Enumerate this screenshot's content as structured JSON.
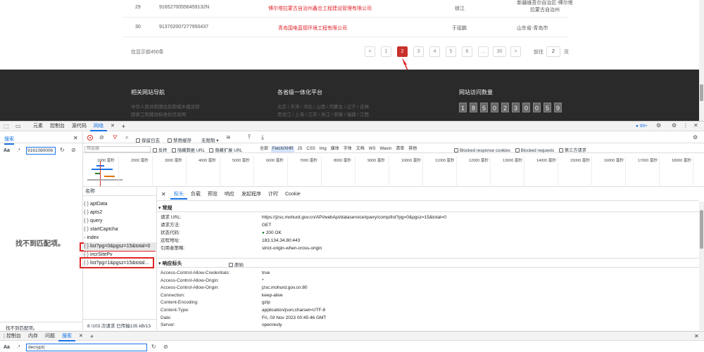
{
  "table_rows": [
    {
      "num": "29",
      "code": "91652700556459132N",
      "company": "博尔塔拉蒙古自治州鑫合工程建设管理有限公司",
      "person": "徐江",
      "region": "新疆维吾尔自治区-博尔塔拉蒙古自治州"
    },
    {
      "num": "30",
      "code": "913702007277950437",
      "company": "青岛国电蓝德环境工程有限公司",
      "person": "于延鹏",
      "region": "山东省-青岛市"
    }
  ],
  "pagination": {
    "summary": "仅显示前450条",
    "prev": "<",
    "pages": [
      "1",
      "2",
      "3",
      "4",
      "5",
      "6",
      "...",
      "30"
    ],
    "active": "2",
    "next": ">",
    "goto_label": "前往",
    "goto_value": "2",
    "goto_suffix": "页"
  },
  "footer": {
    "nav_title": "相关网站导航",
    "nav_links": [
      "中华人民共和国住房和城乡建设部",
      "国家工程建设标准化信息网"
    ],
    "province_title": "各省级一体化平台",
    "province_line1": "北京 / 天津 / 河北 / 山西 / 内蒙古 / 辽宁 / 吉林",
    "province_line2": "黑龙江 / 上海 / 江苏 / 浙江 / 安徽 / 福建 / 江西",
    "visits_title": "网站访问数量",
    "visits_digits": [
      "1",
      "8",
      "5",
      "0",
      "2",
      "3",
      "0",
      "0",
      "5",
      "9"
    ]
  },
  "devtools": {
    "top_tabs": [
      "元素",
      "控制台",
      "源代码",
      "网络"
    ],
    "active_top_tab": "网络",
    "badge": "99+",
    "search_panel": {
      "title": "搜索",
      "aa": "Aa",
      "regex": ".*",
      "query": "9161080006",
      "no_match": "找不到匹配项。",
      "status": "找不到匹配项。"
    },
    "toolbar": {
      "preserve_log": "保留日志",
      "disable_cache": "禁用缓存",
      "throttle": "无限制"
    },
    "filter": {
      "placeholder": "筛选器",
      "invert": "反转",
      "hide_data_urls": "隐藏数据 URL",
      "hide_ext_urls": "隐藏扩展 URL",
      "chips": [
        "全部",
        "Fetch/XHR",
        "JS",
        "CSS",
        "Img",
        "媒体",
        "字体",
        "文档",
        "WS",
        "Wasm",
        "清单",
        "其他"
      ],
      "active_chip": "Fetch/XHR",
      "blocked_cookies": "Blocked response cookies",
      "blocked_requests": "Blocked requests",
      "third_party": "第三方请求"
    },
    "timeline_ticks": [
      "1000 毫秒",
      "2000 毫秒",
      "3000 毫秒",
      "4000 毫秒",
      "5000 毫秒",
      "6000 毫秒",
      "7000 毫秒",
      "8000 毫秒",
      "9000 毫秒",
      "10000 毫秒",
      "11000 毫秒",
      "12000 毫秒",
      "13000 毫秒",
      "14000 毫秒",
      "15000 毫秒",
      "16000 毫秒",
      "17000 毫秒",
      "18000 毫秒"
    ],
    "request_list": {
      "header": "名称",
      "items": [
        "aptData",
        "apts2",
        "query",
        "startCaptcha",
        "index",
        "list?pg=0&pgsz=15&total=0",
        "incrSitePv",
        "list?pg=1&pgsz=15&total..."
      ],
      "footer": "8 /103 次请求  已传输135 kB/13"
    },
    "detail_tabs": [
      "标头",
      "负载",
      "预览",
      "响应",
      "发起程序",
      "计时",
      "Cookie"
    ],
    "active_detail_tab": "标头",
    "general": {
      "title": "▾ 常规",
      "rows": [
        {
          "k": "请求 URL:",
          "v": "https://jzsc.mohurd.gov.cn/APi/webApi/dataservice/query/comp/list?pg=0&pgsz=15&total=0"
        },
        {
          "k": "请求方法:",
          "v": "GET"
        },
        {
          "k": "状态代码:",
          "v": "200 OK"
        },
        {
          "k": "远程地址:",
          "v": "183.134.34.80:443"
        },
        {
          "k": "引用者策略:",
          "v": "strict-origin-when-cross-origin"
        }
      ]
    },
    "response_headers": {
      "title": "▾ 响应标头",
      "raw": "原始",
      "rows": [
        {
          "k": "Access-Control-Allow-Credentials:",
          "v": "true"
        },
        {
          "k": "Access-Control-Allow-Origin:",
          "v": "*"
        },
        {
          "k": "Access-Control-Allow-Origin:",
          "v": "jzsc.mohurd.gov.cn:80"
        },
        {
          "k": "Connection:",
          "v": "keep-alive"
        },
        {
          "k": "Content-Encoding:",
          "v": "gzip"
        },
        {
          "k": "Content-Type:",
          "v": "application/json;charset=UTF-8"
        },
        {
          "k": "Date:",
          "v": "Fri, 03 Nov 2023 00:45:46 GMT"
        },
        {
          "k": "Server:",
          "v": "openresty"
        }
      ]
    },
    "drawer_tabs": [
      "控制台",
      "内存",
      "问题",
      "搜索"
    ],
    "active_drawer_tab": "搜索",
    "drawer_search": {
      "aa": "Aa",
      "regex": ".*",
      "query": "decrypt("
    }
  },
  "colors": {
    "accent": "#1a73e8",
    "page_red": "#c8302a",
    "annotation_red": "#e02424"
  }
}
